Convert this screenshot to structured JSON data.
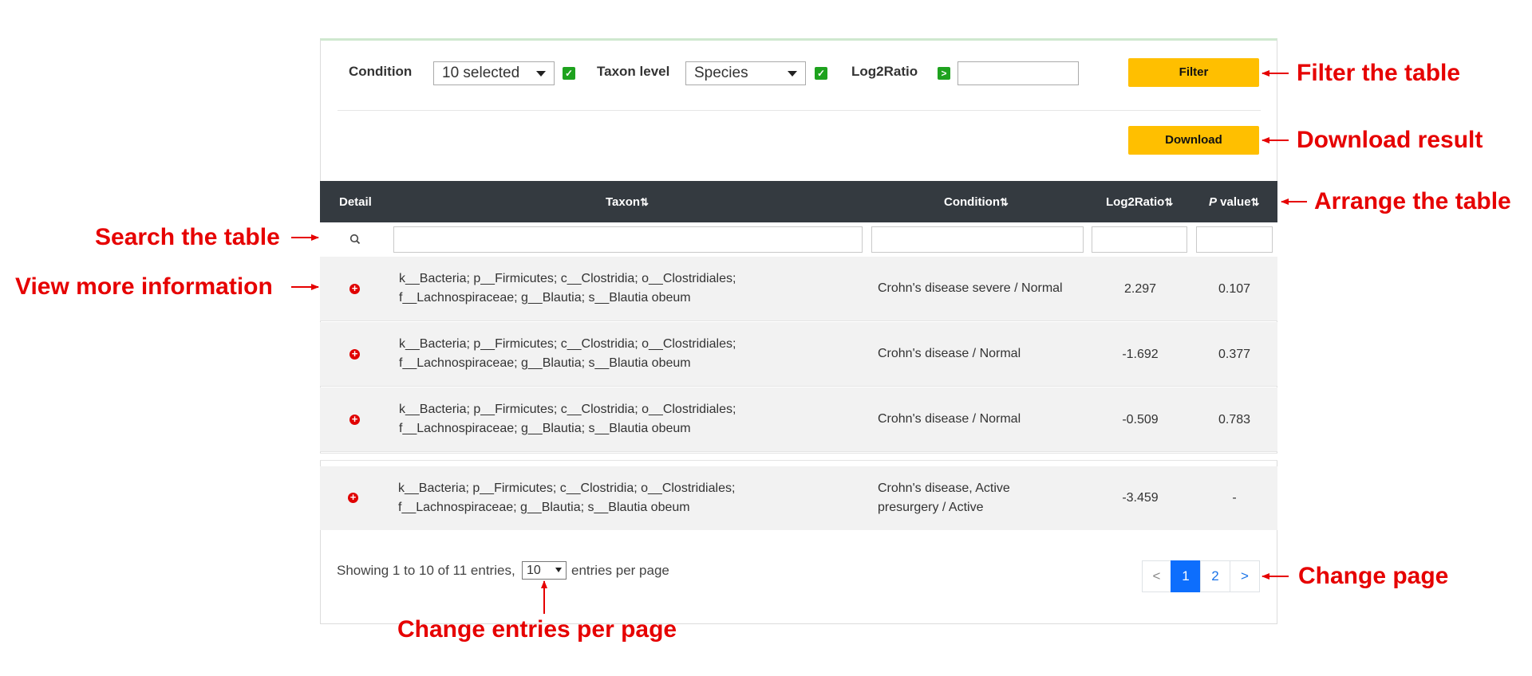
{
  "filter_bar": {
    "condition_label": "Condition",
    "condition_value": "10 selected",
    "taxon_level_label": "Taxon level",
    "taxon_level_value": "Species",
    "log2ratio_label": "Log2Ratio",
    "log2ratio_operator": ">",
    "log2ratio_value": "",
    "filter_button": "Filter",
    "download_button": "Download"
  },
  "table": {
    "columns": {
      "detail": "Detail",
      "taxon": "Taxon",
      "condition": "Condition",
      "log2ratio": "Log2Ratio",
      "pvalue_italic": "P",
      "pvalue_rest": " value"
    },
    "rows": [
      {
        "taxon_line1": "k__Bacteria; p__Firmicutes; c__Clostridia; o__Clostridiales;",
        "taxon_line2": "f__Lachnospiraceae; g__Blautia; s__Blautia obeum",
        "condition_line1": "Crohn's disease severe / Normal",
        "condition_line2": "",
        "log2ratio": "2.297",
        "pvalue": "0.107"
      },
      {
        "taxon_line1": "k__Bacteria; p__Firmicutes; c__Clostridia; o__Clostridiales;",
        "taxon_line2": "f__Lachnospiraceae; g__Blautia; s__Blautia obeum",
        "condition_line1": "Crohn's disease / Normal",
        "condition_line2": "",
        "log2ratio": "-1.692",
        "pvalue": "0.377"
      },
      {
        "taxon_line1": "k__Bacteria; p__Firmicutes; c__Clostridia; o__Clostridiales;",
        "taxon_line2": "f__Lachnospiraceae; g__Blautia; s__Blautia obeum",
        "condition_line1": "Crohn's disease / Normal",
        "condition_line2": "",
        "log2ratio": "-0.509",
        "pvalue": "0.783"
      },
      {
        "taxon_line1": "k__Bacteria; p__Firmicutes; c__Clostridia; o__Clostridiales;",
        "taxon_line2": "f__Lachnospiraceae; g__Blautia; s__Blautia obeum",
        "condition_line1": "Crohn's disease, Active",
        "condition_line2": "presurgery / Active",
        "log2ratio": "-3.459",
        "pvalue": "-"
      }
    ]
  },
  "footer": {
    "showing_text": "Showing 1 to 10 of 11 entries,",
    "per_page_value": "10",
    "per_page_suffix": "entries per page"
  },
  "pagination": {
    "prev": "<",
    "page1": "1",
    "page2": "2",
    "next": ">"
  },
  "annotations": {
    "filter": "Filter the table",
    "download": "Download result",
    "arrange": "Arrange the table",
    "search": "Search the table",
    "view_more": "View more information",
    "change_page": "Change page",
    "entries_per_page": "Change entries per page"
  },
  "colors": {
    "button_yellow": "#ffbf00",
    "header_dark": "#343a40",
    "annotation_red": "#e60000",
    "checkbox_green": "#1ea21e",
    "page_active_blue": "#0d6efd"
  },
  "icons": [
    "search-icon",
    "plus-circle-icon",
    "sort-icon",
    "dropdown-caret-icon",
    "checkbox-icon"
  ]
}
